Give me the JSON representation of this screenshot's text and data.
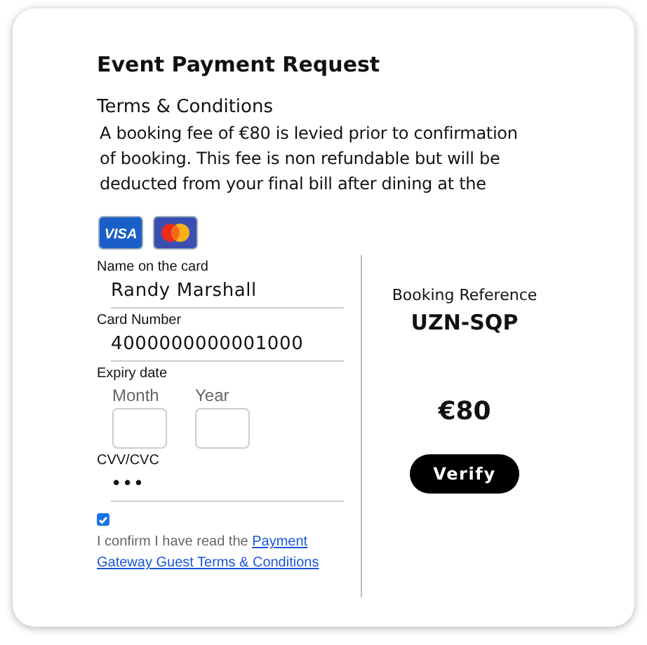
{
  "title": "Event Payment Request",
  "terms": {
    "heading": "Terms & Conditions",
    "text": "A booking fee of €80 is levied prior to confirmation of booking. This fee is non refundable but will be deducted from your final bill after dining at the"
  },
  "card_logos": [
    {
      "kind": "visa",
      "text": "VISA"
    },
    {
      "kind": "mastercard"
    }
  ],
  "form": {
    "name": {
      "label": "Name on the card",
      "value": "Randy Marshall"
    },
    "number": {
      "label": "Card Number",
      "value": "4000000000001000"
    },
    "expiry": {
      "label": "Expiry date",
      "month_label": "Month",
      "year_label": "Year"
    },
    "cvv": {
      "label": "CVV/CVC",
      "value": "•••"
    },
    "confirm": {
      "checked": true,
      "text": "I confirm I have read the ",
      "link_lines": [
        "Payment",
        "Gateway Guest Terms & Conditions"
      ]
    }
  },
  "summary": {
    "reference_label": "Booking Reference",
    "reference": "UZN-SQP",
    "amount": "€80",
    "button": "Verify"
  }
}
